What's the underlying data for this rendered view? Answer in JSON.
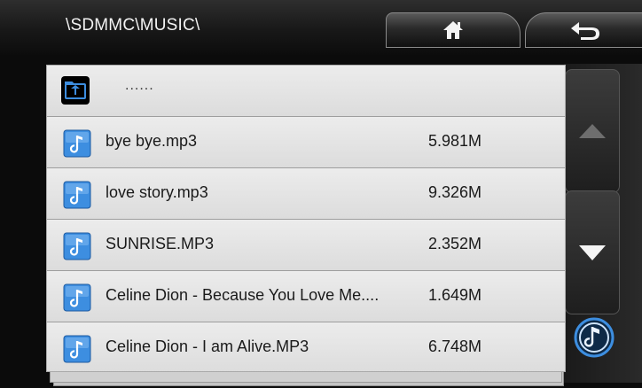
{
  "header": {
    "path": "\\SDMMC\\MUSIC\\",
    "home_icon": "home-icon",
    "back_icon": "return-arrow-icon"
  },
  "list": {
    "parent_label": "......",
    "items": [
      {
        "name": "bye bye.mp3",
        "size": "5.981M"
      },
      {
        "name": "love story.mp3",
        "size": "9.326M"
      },
      {
        "name": "SUNRISE.MP3",
        "size": "2.352M"
      },
      {
        "name": "Celine Dion - Because You Love Me....",
        "size": "1.649M"
      },
      {
        "name": "Celine Dion - I am Alive.MP3",
        "size": "6.748M"
      }
    ]
  },
  "colors": {
    "accent_blue": "#3d8ee0",
    "folder_icon_bg": "#0a3a6a"
  }
}
